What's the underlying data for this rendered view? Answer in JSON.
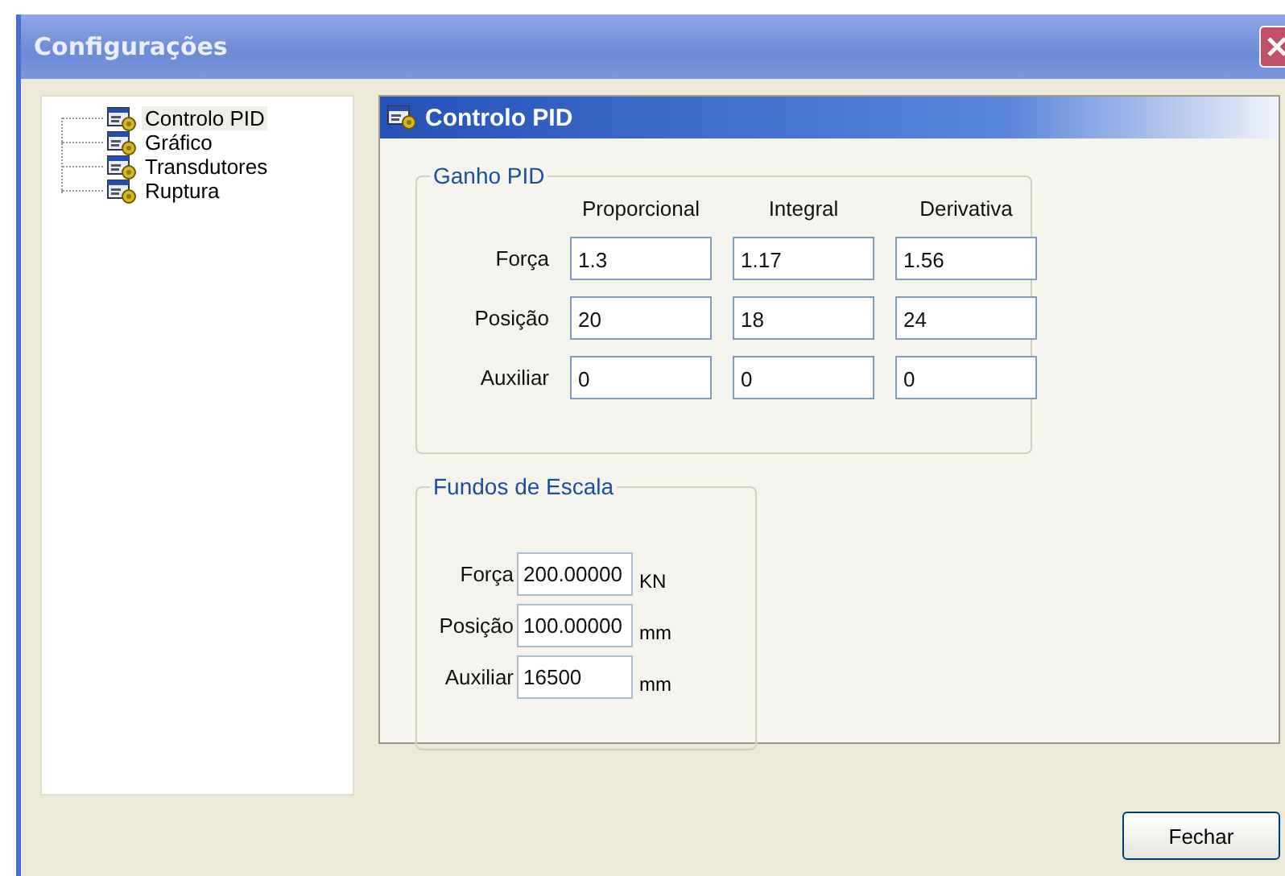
{
  "window": {
    "title": "Configurações"
  },
  "sidebar": {
    "items": [
      {
        "label": "Controlo PID",
        "selected": true
      },
      {
        "label": "Gráfico",
        "selected": false
      },
      {
        "label": "Transdutores",
        "selected": false
      },
      {
        "label": "Ruptura",
        "selected": false
      }
    ]
  },
  "panel": {
    "title": "Controlo PID"
  },
  "gain_group": {
    "title": "Ganho PID",
    "columns": [
      "Proporcional",
      "Integral",
      "Derivativa"
    ],
    "rows": [
      {
        "label": "Força",
        "values": [
          "1.3",
          "1.17",
          "1.56"
        ]
      },
      {
        "label": "Posição",
        "values": [
          "20",
          "18",
          "24"
        ]
      },
      {
        "label": "Auxiliar",
        "values": [
          "0",
          "0",
          "0"
        ]
      }
    ]
  },
  "scale_group": {
    "title": "Fundos de Escala",
    "rows": [
      {
        "label": "Força",
        "value": "200.00000",
        "unit": "KN"
      },
      {
        "label": "Posição",
        "value": "100.00000",
        "unit": "mm"
      },
      {
        "label": "Auxiliar",
        "value": "16500",
        "unit": "mm"
      }
    ]
  },
  "buttons": [
    "Fechar"
  ]
}
